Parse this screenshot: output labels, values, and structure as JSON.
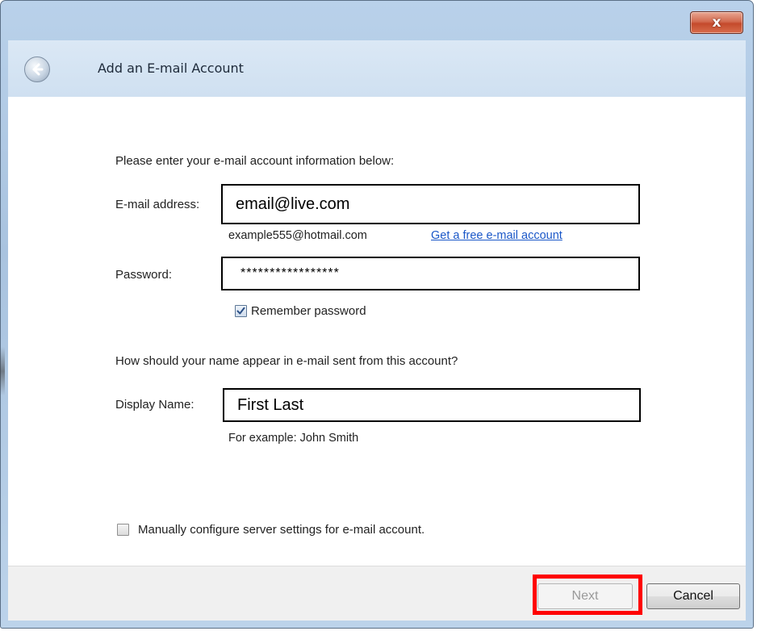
{
  "window": {
    "title": "Add an E-mail Account",
    "close_glyph": "x"
  },
  "icons": {
    "back": "back-arrow-icon",
    "close": "close-icon",
    "check": "checkmark-icon"
  },
  "colors": {
    "link": "#1a57c8",
    "highlight": "#ff0000",
    "close_button": "#c44a2c"
  },
  "form": {
    "intro": "Please enter your e-mail account information below:",
    "email": {
      "label": "E-mail address:",
      "value": "email@live.com",
      "example": "example555@hotmail.com",
      "link": "Get a free e-mail account"
    },
    "password": {
      "label": "Password:",
      "value": "*****************",
      "remember_label": "Remember password",
      "remember_checked": true
    },
    "display_prompt": "How should your name appear in e-mail sent from this account?",
    "display_name": {
      "label": "Display Name:",
      "value": "First Last",
      "example": "For example: John Smith"
    },
    "manual": {
      "label": "Manually configure server settings for e-mail account.",
      "checked": false
    }
  },
  "footer": {
    "next_label": "Next",
    "next_enabled": false,
    "cancel_label": "Cancel"
  }
}
